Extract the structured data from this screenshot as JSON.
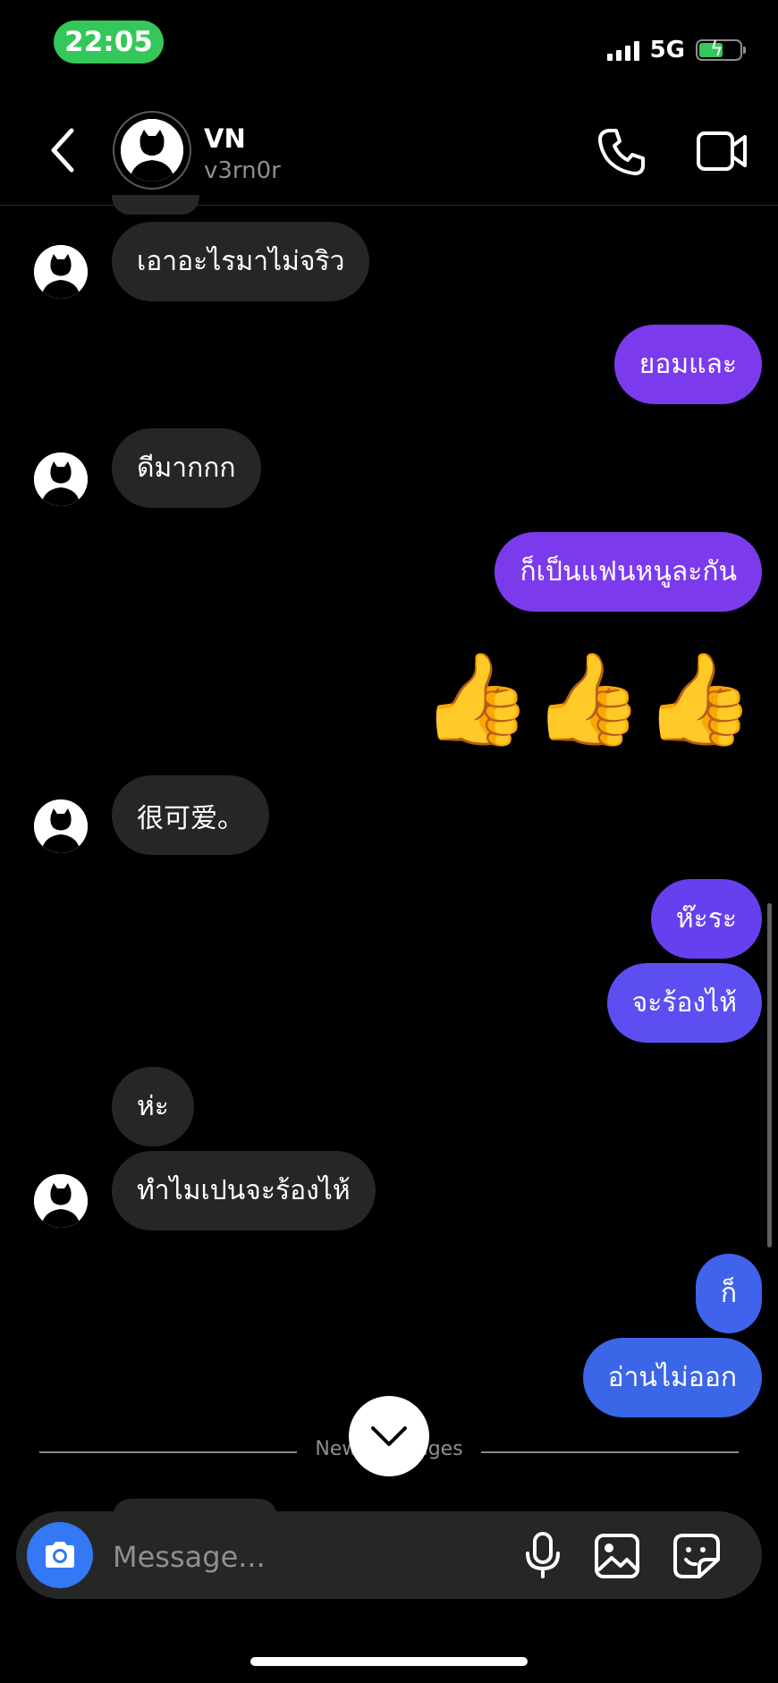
{
  "status_bar": {
    "time": "22:05",
    "network": "5G",
    "time_color": "#34c759"
  },
  "header": {
    "name": "VN",
    "username": "v3rn0r"
  },
  "messages": [
    {
      "side": "in",
      "text": "เอาอะไรมาไม่จริว"
    },
    {
      "side": "out",
      "text": "ยอมและ",
      "color": "#7c3aed"
    },
    {
      "side": "in",
      "text": "ดีมากกก"
    },
    {
      "side": "out",
      "text": "ก็เป็นแฟนหนูละกัน",
      "color": "#7c3aed"
    },
    {
      "side": "out",
      "text": "👍👍👍",
      "type": "emoji"
    },
    {
      "side": "in",
      "text": "很可爱。"
    },
    {
      "side": "out",
      "text": "ห๊ะระ",
      "color": "#6640ee"
    },
    {
      "side": "out",
      "text": "จะร้องไห้",
      "color": "#5c4ef0"
    },
    {
      "side": "in",
      "text": "ห่ะ"
    },
    {
      "side": "in",
      "text": "ทำไมเปนจะร้องไห้"
    },
    {
      "side": "out",
      "text": "ก็",
      "color": "#3f63ea"
    },
    {
      "side": "out",
      "text": "อ่านไม่ออก",
      "color": "#3b66e8"
    }
  ],
  "divider": {
    "text": "New messages"
  },
  "composer": {
    "placeholder": "Message..."
  }
}
